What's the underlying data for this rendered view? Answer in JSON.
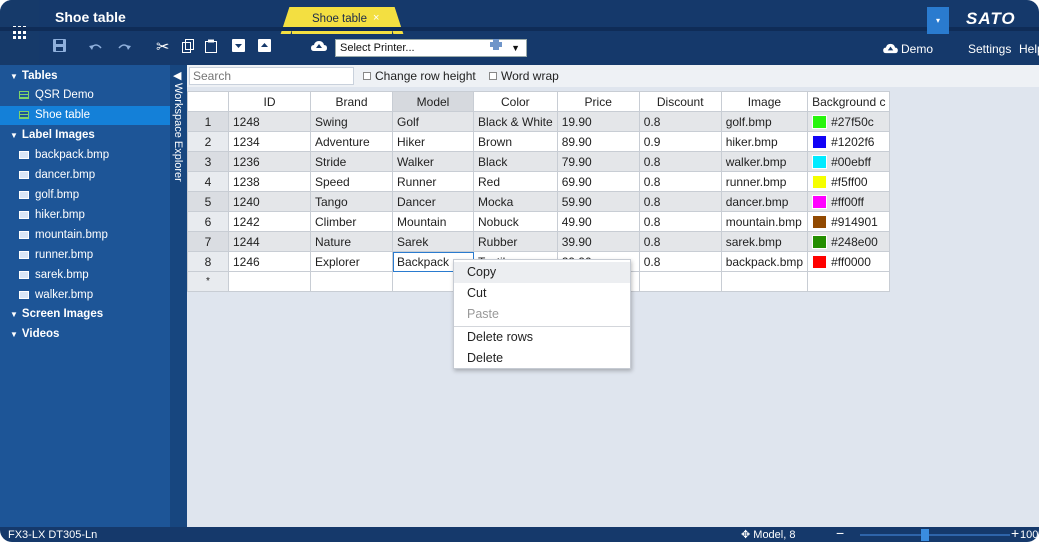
{
  "app": {
    "title": "Shoe table",
    "tab_label": "Shoe table",
    "tab_close": "×",
    "brand": "SATO",
    "brand_dropdown": "▾"
  },
  "toolbar": {
    "printer_select": "Select Printer...",
    "demo": "Demo",
    "settings": "Settings",
    "help": "Help",
    "icons": [
      "save-icon",
      "undo-icon",
      "redo-icon",
      "cut-icon",
      "copy-icon",
      "paste-icon",
      "insert-row-icon",
      "add-row-icon",
      "cloud-icon",
      "printer-icon"
    ]
  },
  "sidebar": {
    "strip_label": "Workspace Explorer",
    "sections": [
      {
        "label": "Tables",
        "items": [
          "QSR Demo",
          "Shoe table"
        ]
      },
      {
        "label": "Label Images",
        "items": [
          "backpack.bmp",
          "dancer.bmp",
          "golf.bmp",
          "hiker.bmp",
          "mountain.bmp",
          "runner.bmp",
          "sarek.bmp",
          "walker.bmp"
        ]
      },
      {
        "label": "Screen Images",
        "items": []
      },
      {
        "label": "Videos",
        "items": []
      }
    ],
    "selected": "Shoe table"
  },
  "search": {
    "placeholder": "Search",
    "change_row_height": "Change row height",
    "word_wrap": "Word wrap"
  },
  "table": {
    "columns": [
      "ID",
      "Brand",
      "Model",
      "Color",
      "Price",
      "Discount",
      "Image",
      "Background c"
    ],
    "rows": [
      {
        "n": "1",
        "id": "1248",
        "brand": "Swing",
        "model": "Golf",
        "color": "Black & White",
        "price": "19.90",
        "discount": "0.8",
        "image": "golf.bmp",
        "bg": "#27f50c"
      },
      {
        "n": "2",
        "id": "1234",
        "brand": "Adventure",
        "model": "Hiker",
        "color": "Brown",
        "price": "89.90",
        "discount": "0.9",
        "image": "hiker.bmp",
        "bg": "#1202f6"
      },
      {
        "n": "3",
        "id": "1236",
        "brand": "Stride",
        "model": "Walker",
        "color": "Black",
        "price": "79.90",
        "discount": "0.8",
        "image": "walker.bmp",
        "bg": "#00ebff"
      },
      {
        "n": "4",
        "id": "1238",
        "brand": "Speed",
        "model": "Runner",
        "color": "Red",
        "price": "69.90",
        "discount": "0.8",
        "image": "runner.bmp",
        "bg": "#f5ff00"
      },
      {
        "n": "5",
        "id": "1240",
        "brand": "Tango",
        "model": "Dancer",
        "color": "Mocka",
        "price": "59.90",
        "discount": "0.8",
        "image": "dancer.bmp",
        "bg": "#ff00ff"
      },
      {
        "n": "6",
        "id": "1242",
        "brand": "Climber",
        "model": "Mountain",
        "color": "Nobuck",
        "price": "49.90",
        "discount": "0.8",
        "image": "mountain.bmp",
        "bg": "#914901"
      },
      {
        "n": "7",
        "id": "1244",
        "brand": "Nature",
        "model": "Sarek",
        "color": "Rubber",
        "price": "39.90",
        "discount": "0.8",
        "image": "sarek.bmp",
        "bg": "#248e00"
      },
      {
        "n": "8",
        "id": "1246",
        "brand": "Explorer",
        "model": "Backpack",
        "color": "Textile",
        "price": "29.90",
        "discount": "0.8",
        "image": "backpack.bmp",
        "bg": "#ff0000"
      }
    ],
    "new_row_marker": "*"
  },
  "context_menu": {
    "items": [
      "Copy",
      "Cut",
      "Paste",
      "Delete rows",
      "Delete"
    ],
    "disabled": [
      "Paste"
    ]
  },
  "status": {
    "printer": "FX3-LX DT305-Ln",
    "model": "Model, 8",
    "zoom": "100%",
    "zoom_fraction": 0.43
  }
}
